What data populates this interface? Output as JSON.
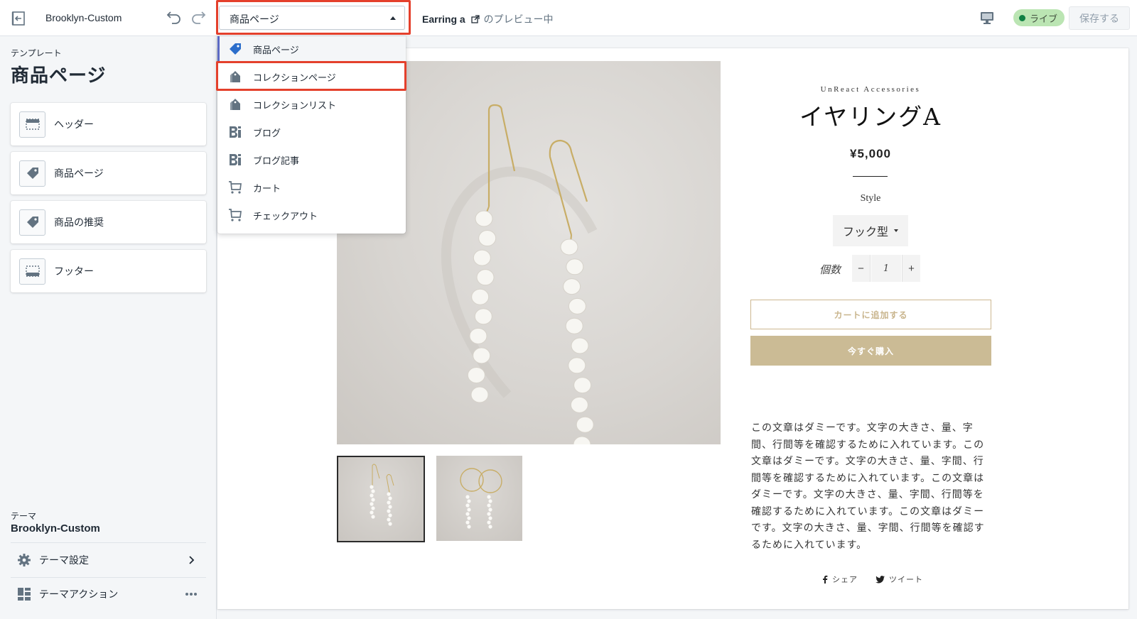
{
  "topbar": {
    "theme_name": "Brooklyn-Custom",
    "template_select": "商品ページ",
    "preview_product": "Earring a",
    "preview_suffix": "のプレビュー中",
    "live_label": "ライブ",
    "save_label": "保存する"
  },
  "sidebar": {
    "caption": "テンプレート",
    "title": "商品ページ",
    "sections": [
      {
        "label": "ヘッダー",
        "icon": "header-layout-icon"
      },
      {
        "label": "商品ページ",
        "icon": "tag-icon"
      },
      {
        "label": "商品の推奨",
        "icon": "tag-icon"
      },
      {
        "label": "フッター",
        "icon": "footer-layout-icon"
      }
    ],
    "theme_caption": "テーマ",
    "theme_name": "Brooklyn-Custom",
    "theme_settings_label": "テーマ設定",
    "theme_actions_label": "テーマアクション"
  },
  "dropdown": {
    "items": [
      {
        "label": "商品ページ",
        "icon": "tag-icon",
        "selected": true
      },
      {
        "label": "コレクションページ",
        "icon": "collection-tags-icon",
        "selected": false
      },
      {
        "label": "コレクションリスト",
        "icon": "collection-tags-icon",
        "selected": false
      },
      {
        "label": "ブログ",
        "icon": "blog-icon",
        "selected": false
      },
      {
        "label": "ブログ記事",
        "icon": "blog-icon",
        "selected": false
      },
      {
        "label": "カート",
        "icon": "cart-icon",
        "selected": false
      },
      {
        "label": "チェックアウト",
        "icon": "cart-icon",
        "selected": false
      }
    ]
  },
  "product": {
    "vendor": "UnReact Accessories",
    "title": "イヤリングA",
    "price": "¥5,000",
    "style_label": "Style",
    "style_value": "フック型",
    "quantity_label": "個数",
    "quantity_minus": "−",
    "quantity": "1",
    "quantity_plus": "+",
    "add_to_cart": "カートに追加する",
    "buy_now": "今すぐ購入",
    "description": "この文章はダミーです。文字の大きさ、量、字間、行間等を確認するために入れています。この文章はダミーです。文字の大きさ、量、字間、行間等を確認するために入れています。この文章はダミーです。文字の大きさ、量、字間、行間等を確認するために入れています。この文章はダミーです。文字の大きさ、量、字間、行間等を確認するために入れています。",
    "share_label": "シェア",
    "tweet_label": "ツイート"
  },
  "colors": {
    "highlight": "#e4402c",
    "live_badge": "#bbe5b3",
    "accent_gold": "#cbbb95",
    "selected_bar": "#5c6ac4"
  }
}
